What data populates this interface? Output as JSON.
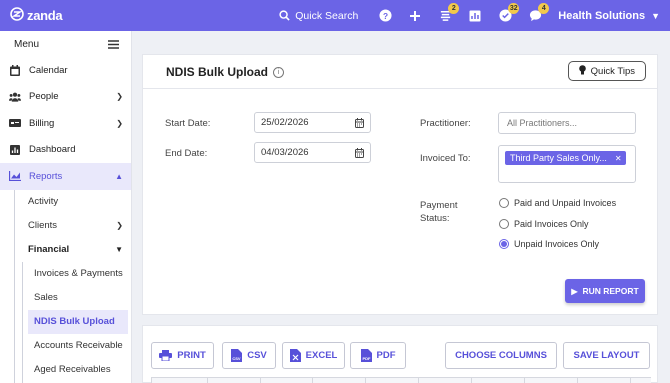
{
  "topbar": {
    "logo": "zanda",
    "search_label": "Quick Search",
    "badges": {
      "notes": "2",
      "tasks": "32",
      "messages": "4"
    },
    "org_name": "Health Solutions"
  },
  "sidebar": {
    "menu_label": "Menu",
    "items": [
      {
        "label": "Calendar"
      },
      {
        "label": "People"
      },
      {
        "label": "Billing"
      },
      {
        "label": "Dashboard"
      },
      {
        "label": "Reports"
      }
    ],
    "reports_sub": [
      {
        "label": "Activity"
      },
      {
        "label": "Clients"
      },
      {
        "label": "Financial"
      }
    ],
    "financial_sub": [
      {
        "label": "Invoices & Payments"
      },
      {
        "label": "Sales"
      },
      {
        "label": "NDIS Bulk Upload"
      },
      {
        "label": "Accounts Receivable"
      },
      {
        "label": "Aged Receivables"
      }
    ]
  },
  "report": {
    "title": "NDIS Bulk Upload",
    "quick_tips": "Quick Tips",
    "start_date_label": "Start Date:",
    "start_date": "25/02/2026",
    "end_date_label": "End Date:",
    "end_date": "04/03/2026",
    "practitioner_label": "Practitioner:",
    "practitioner_placeholder": "All Practitioners...",
    "invoiced_to_label": "Invoiced To:",
    "invoiced_to_chip": "Third Party Sales Only...",
    "payment_label_1": "Payment",
    "payment_label_2": "Status:",
    "payment_options": [
      {
        "label": "Paid and Unpaid Invoices",
        "selected": false
      },
      {
        "label": "Paid Invoices Only",
        "selected": false
      },
      {
        "label": "Unpaid Invoices Only",
        "selected": true
      }
    ],
    "run_label": "RUN REPORT"
  },
  "toolbar": {
    "print": "PRINT",
    "csv": "CSV",
    "excel": "EXCEL",
    "pdf": "PDF",
    "choose_columns": "CHOOSE COLUMNS",
    "save_layout": "SAVE LAYOUT"
  },
  "colors": {
    "accent": "#6b64e6",
    "badge": "#f2c94c"
  }
}
